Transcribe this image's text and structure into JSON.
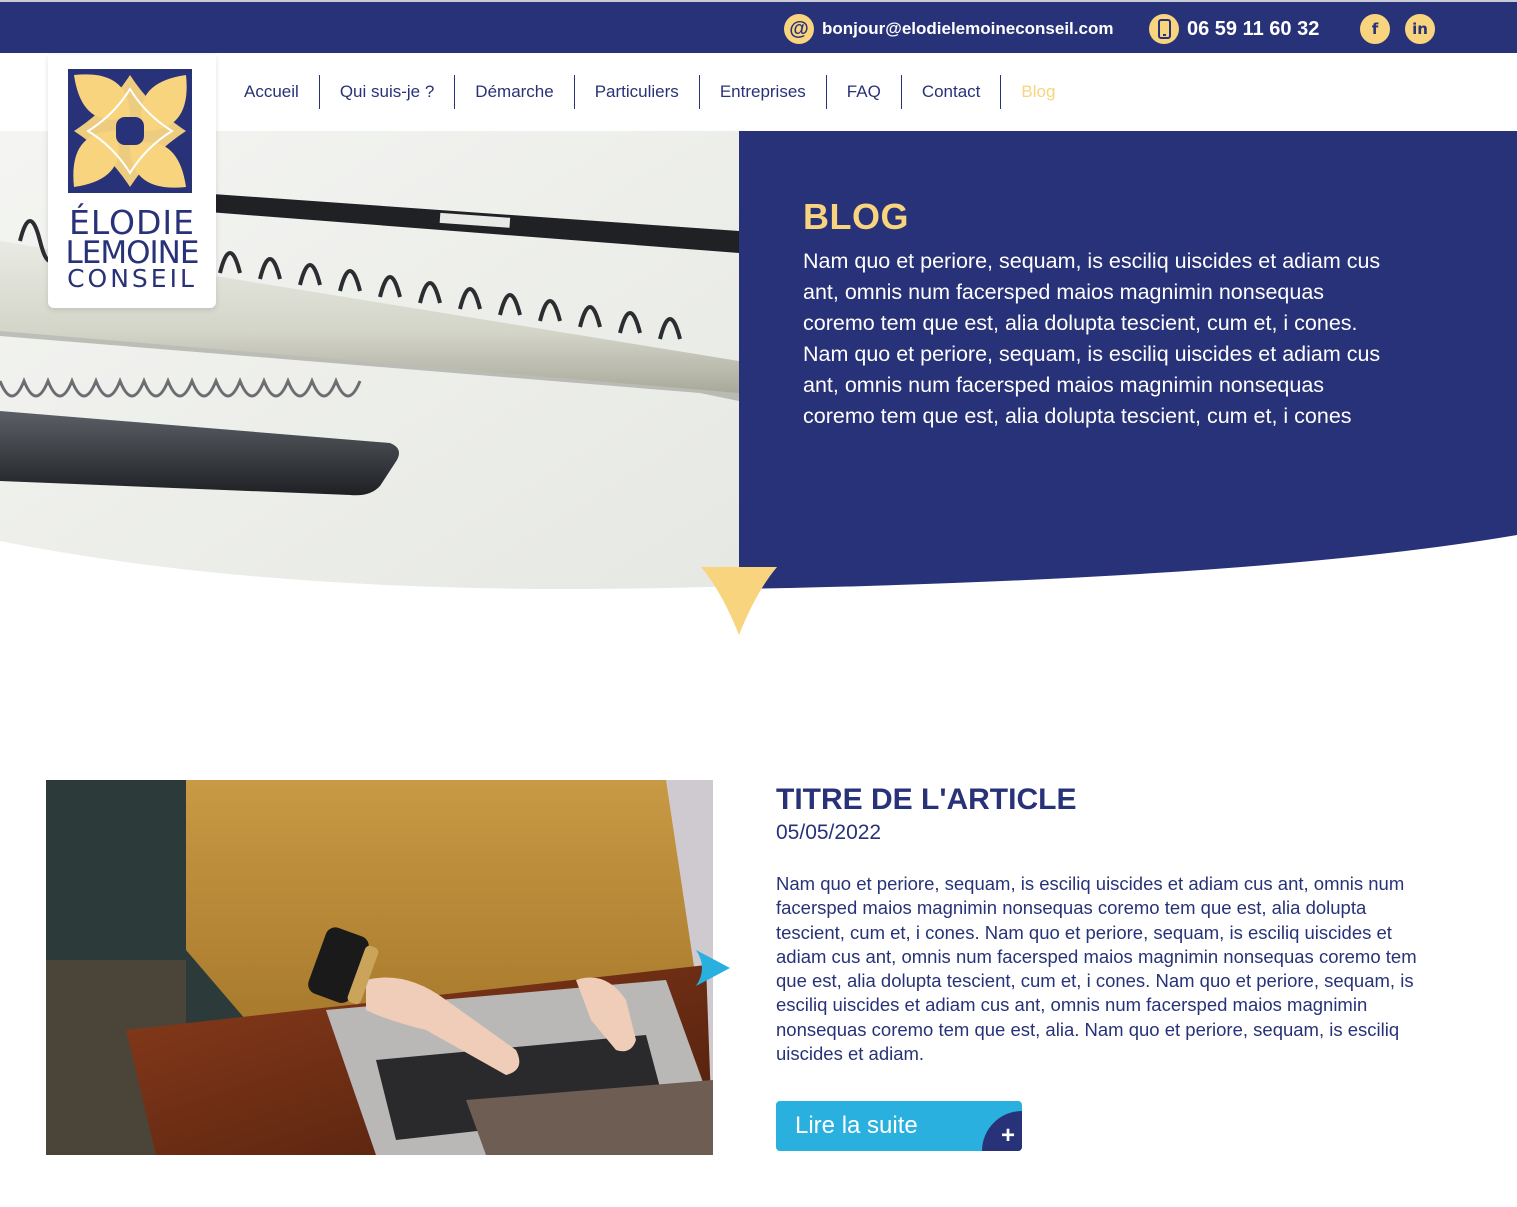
{
  "topbar": {
    "email": "bonjour@elodielemoineconseil.com",
    "email_icon": "@",
    "phone": "06 59 11 60 32",
    "social": [
      {
        "name": "facebook",
        "glyph": "f"
      },
      {
        "name": "linkedin",
        "glyph": "in"
      }
    ]
  },
  "logo": {
    "line1": "ÉLODIE",
    "line2": "LEMOINE",
    "line3": "CONSEIL"
  },
  "nav": {
    "items": [
      {
        "label": "Accueil"
      },
      {
        "label": "Qui suis-je ?"
      },
      {
        "label": "Démarche"
      },
      {
        "label": "Particuliers"
      },
      {
        "label": "Entreprises"
      },
      {
        "label": "FAQ"
      },
      {
        "label": "Contact"
      },
      {
        "label": "Blog",
        "active": true
      }
    ]
  },
  "hero": {
    "title": "BLOG",
    "text": "Nam quo et periore, sequam, is esciliq uiscides et adiam cus ant, omnis num facersped maios magnimin nonsequas coremo tem que est, alia dolupta tescient, cum et, i cones. Nam quo et periore, sequam, is esciliq uiscides et adiam cus ant, omnis num facersped maios magnimin nonsequas coremo tem que est, alia dolupta tescient, cum et, i cones"
  },
  "article": {
    "title": "TITRE DE L'ARTICLE",
    "date": "05/05/2022",
    "text": "Nam quo et periore, sequam, is esciliq uiscides et adiam cus ant, omnis num facersped maios magnimin nonsequas coremo tem que est, alia dolupta tescient, cum et, i cones. Nam quo et periore, sequam, is esciliq uiscides et adiam cus ant, omnis num facersped maios magnimin nonsequas coremo tem que est, alia dolupta tescient, cum et, i cones. Nam quo et periore, sequam, is esciliq uiscides et adiam cus ant, omnis num facersped maios magnimin nonsequas coremo tem que est, alia. Nam quo et periore, sequam, is esciliq uiscides et adiam.",
    "read_more_label": "Lire la suite",
    "read_more_icon": "+"
  },
  "colors": {
    "navy": "#283278",
    "yellow": "#f8d47f",
    "cyan": "#29b0de",
    "white": "#ffffff"
  }
}
